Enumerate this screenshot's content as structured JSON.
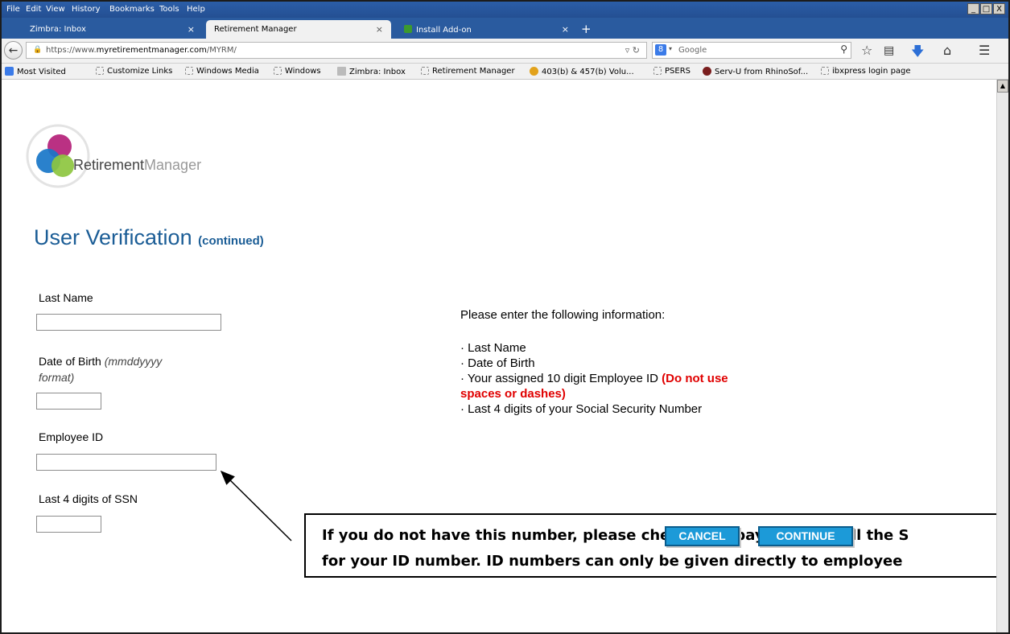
{
  "menubar": {
    "items": [
      "File",
      "Edit",
      "View",
      "History",
      "Bookmarks",
      "Tools",
      "Help"
    ]
  },
  "window_buttons": [
    "_",
    "□",
    "X"
  ],
  "tabs": [
    {
      "label": "Zimbra: Inbox",
      "close": "×"
    },
    {
      "label": "Retirement Manager",
      "close": "×"
    },
    {
      "label": "Install Add-on",
      "close": "×"
    }
  ],
  "new_tab": "+",
  "nav": {
    "url_prefix": "https://www.",
    "url_host": "myretirementmanager.com",
    "url_path": "/MYRM/",
    "search_placeholder": "Google",
    "search_engine": "8"
  },
  "bookmarks": [
    "Most Visited",
    "Customize Links",
    "Windows Media",
    "Windows",
    "Zimbra: Inbox",
    "Retirement Manager",
    "403(b) & 457(b) Volu...",
    "PSERS",
    "Serv-U from RhinoSof...",
    "ibxpress login page"
  ],
  "page": {
    "brand_bold": "Retirement",
    "brand_light": "Manager",
    "title": "User Verification",
    "title_suffix": "(continued)",
    "fields": {
      "last_name_label": "Last Name",
      "dob_label": "Date of Birth",
      "dob_hint_1": "(mmddyyyy",
      "dob_hint_2": "format)",
      "employee_id_label": "Employee ID",
      "ssn_label": "Last 4 digits of SSN",
      "last_name_value": "",
      "dob_value": "",
      "employee_id_value": "",
      "ssn_value": ""
    },
    "info": {
      "intro": "Please enter the following information:",
      "item1": "· Last Name",
      "item2": "· Date of Birth",
      "item3": "· Your assigned 10 digit Employee ID",
      "item3_note_1": "(Do not use",
      "item3_note_2": "spaces or dashes)",
      "item4": "· Last 4 digits of your Social Security Number"
    },
    "callout_line1": "If you do not have this number, please check your paystub, or call the S",
    "callout_line2": "for your ID number. ID numbers can only be given directly to employee",
    "cancel_label": "CANCEL",
    "continue_label": "CONTINUE"
  },
  "colors": {
    "title": "#1b5d96",
    "warning": "#e00000",
    "button": "#1c9ad8",
    "chrome": "#2a5b9f"
  }
}
